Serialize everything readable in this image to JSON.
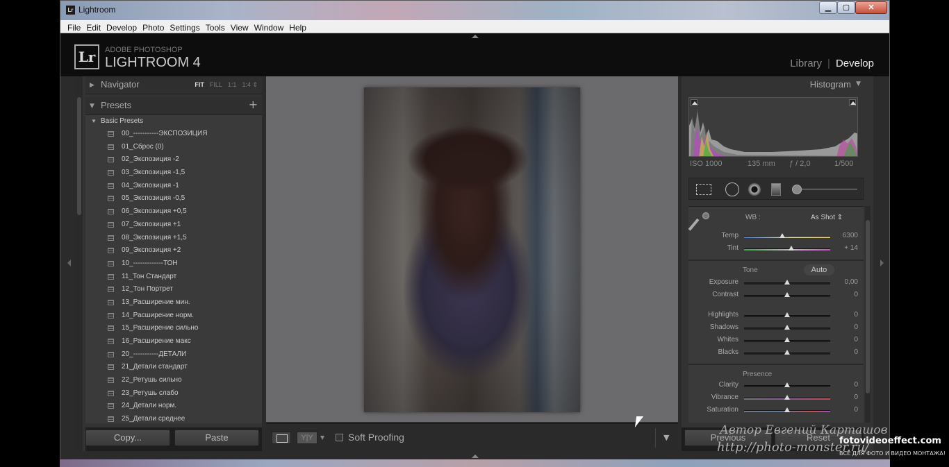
{
  "window": {
    "title": "Lightroom",
    "controls": {
      "minimize": "▁",
      "maximize": "▢",
      "close": "✕"
    }
  },
  "menu": [
    "File",
    "Edit",
    "Develop",
    "Photo",
    "Settings",
    "Tools",
    "View",
    "Window",
    "Help"
  ],
  "brand": {
    "logo": "Lr",
    "line1": "ADOBE PHOTOSHOP",
    "line2": "LIGHTROOM 4"
  },
  "modules": {
    "library": "Library",
    "separator": "|",
    "develop": "Develop"
  },
  "navigator": {
    "title": "Navigator",
    "zooms": [
      "FIT",
      "FILL",
      "1:1",
      "1:4 ⇕"
    ],
    "active_zoom": "FIT"
  },
  "presets": {
    "title": "Presets",
    "add": "+",
    "folder": "Basic Presets",
    "items": [
      "00_-----------ЭКСПОЗИЦИЯ",
      "01_Сброс (0)",
      "02_Экспозиция -2",
      "03_Экспозиция -1,5",
      "04_Экспозиция -1",
      "05_Экспозиция -0,5",
      "06_Экспозиция +0,5",
      "07_Экспозиция +1",
      "08_Экспозиция +1,5",
      "09_Экспозиция +2",
      "10_-------------ТОН",
      "11_Тон Стандарт",
      "12_Тон Портрет",
      "13_Расширение мин.",
      "14_Расширение норм.",
      "15_Расширение сильно",
      "16_Расширение макс",
      "20_-----------ДЕТАЛИ",
      "21_Детали стандарт",
      "22_Ретушь сильно",
      "23_Ретушь слабо",
      "24_Детали норм.",
      "25_Детали среднее"
    ]
  },
  "left_buttons": {
    "copy": "Copy...",
    "paste": "Paste"
  },
  "toolbar": {
    "yy": "Y|Y",
    "soft_proofing": "Soft Proofing"
  },
  "histogram": {
    "title": "Histogram",
    "iso": "ISO 1000",
    "focal": "135 mm",
    "aperture": "ƒ / 2,0",
    "shutter": "1/500"
  },
  "basic": {
    "wb_label": "WB :",
    "wb_value": "As Shot ⇕",
    "sliders_wb": [
      {
        "label": "Temp",
        "value": "6300",
        "pos": 0.44,
        "track": "temp"
      },
      {
        "label": "Tint",
        "value": "+ 14",
        "pos": 0.55,
        "track": "tint"
      }
    ],
    "tone_label": "Tone",
    "auto": "Auto",
    "sliders_tone": [
      {
        "label": "Exposure",
        "value": "0,00",
        "pos": 0.5
      },
      {
        "label": "Contrast",
        "value": "0",
        "pos": 0.5
      }
    ],
    "sliders_tone2": [
      {
        "label": "Highlights",
        "value": "0",
        "pos": 0.5
      },
      {
        "label": "Shadows",
        "value": "0",
        "pos": 0.5
      },
      {
        "label": "Whites",
        "value": "0",
        "pos": 0.5
      },
      {
        "label": "Blacks",
        "value": "0",
        "pos": 0.5
      }
    ],
    "presence_label": "Presence",
    "sliders_presence": [
      {
        "label": "Clarity",
        "value": "0",
        "pos": 0.5,
        "track": ""
      },
      {
        "label": "Vibrance",
        "value": "0",
        "pos": 0.5,
        "track": "vib"
      },
      {
        "label": "Saturation",
        "value": "0",
        "pos": 0.5,
        "track": "sat"
      }
    ]
  },
  "right_buttons": {
    "previous": "Previous",
    "reset": "Reset"
  },
  "watermark": {
    "author": "Автор Евгений Карташов",
    "url": "http://photo-monster.ru/",
    "site": "fotovideoeffect.com",
    "tagline": "ВСЁ ДЛЯ ФОТО И ВИДЕО МОНТАЖА!"
  }
}
